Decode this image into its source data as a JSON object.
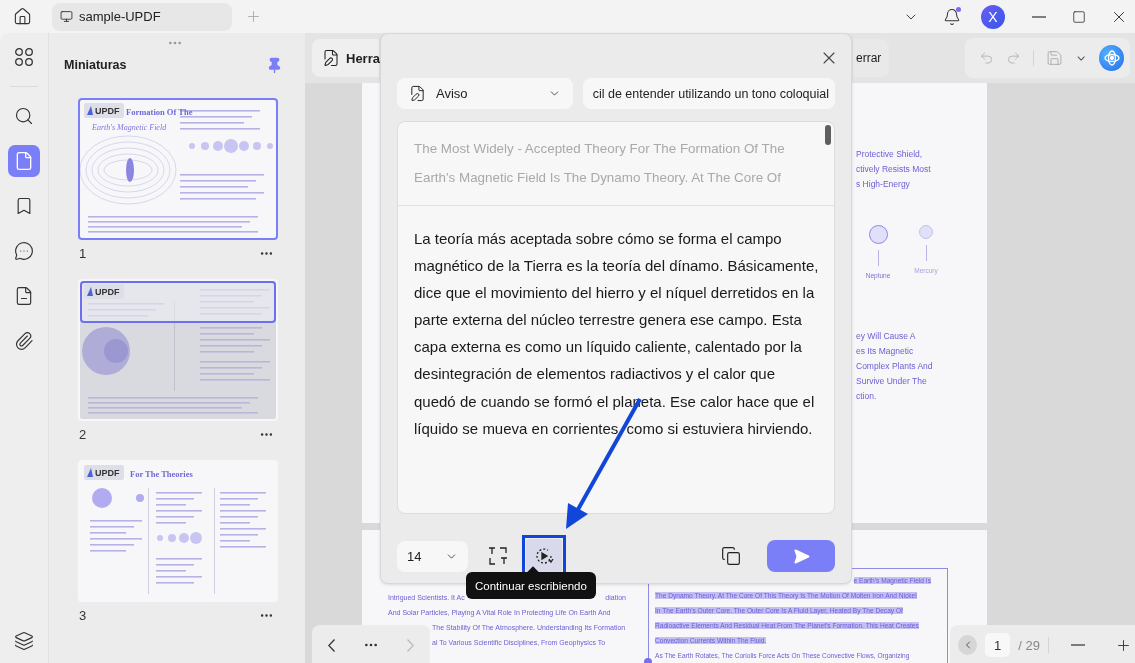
{
  "titlebar": {
    "tab_title": "sample-UPDF",
    "avatar": "X",
    "notification": true
  },
  "rail": {
    "items": [
      {
        "kind": "apps",
        "selected": false
      },
      {
        "kind": "search",
        "selected": false
      },
      {
        "kind": "pages",
        "selected": true
      },
      {
        "kind": "bookmark",
        "selected": false
      },
      {
        "kind": "comment",
        "selected": false
      },
      {
        "kind": "form",
        "selected": false
      },
      {
        "kind": "attachment",
        "selected": false
      },
      {
        "kind": "layers",
        "selected": false
      }
    ]
  },
  "thumbnails": {
    "title": "Miniaturas",
    "pinned": true,
    "pages": [
      {
        "number": "1",
        "kind": "cover",
        "selected": true,
        "shaded": false,
        "logo": "UPDF",
        "titles": [
          "Formation Of The",
          "Earth's Magnetic Field"
        ]
      },
      {
        "number": "2",
        "kind": "diagram",
        "selected": false,
        "shaded": true,
        "logo": "UPDF"
      },
      {
        "number": "3",
        "kind": "theories",
        "selected": false,
        "shaded": false,
        "logo": "UPDF",
        "titles": [
          "For The Theories"
        ]
      }
    ]
  },
  "toolbar": {
    "tools_tab": "Herra",
    "close_label": "errar"
  },
  "document": {
    "page_one": {
      "top_lines": [
        "Protective Shield,",
        "ctively Resists Most",
        "s High-Energy"
      ],
      "planets": [
        {
          "label": "Neptune",
          "selected": true
        },
        {
          "label": "Mercury",
          "selected": false
        }
      ],
      "bottom_lines": [
        "ey Will Cause A",
        "es Its Magnetic",
        "Complex Plants And",
        "Survive Under The",
        "ction."
      ]
    },
    "page_two": {
      "left_lines": [
        {
          "text": "Intrigued Scientists. It Ac",
          "tail": "diation",
          "kind": "full"
        },
        {
          "text": "And Solar Particles, Playing A Vital Role In Protecting Life On Earth And",
          "kind": "full"
        },
        {
          "text": "The Stability Of The Atmosphere. Understanding Its Formation",
          "kind": "clipped"
        },
        {
          "text": "al To Various Scientific Disciplines, From Geophysics To",
          "kind": "clipped"
        }
      ],
      "right_lines": [
        {
          "text": "e Earth's Magnetic Field Is",
          "kind": "clipped",
          "selected": true
        },
        {
          "text": "The Dynamo Theory. At The Core Of This Theory Is The Motion Of Molten Iron And Nickel",
          "kind": "full",
          "selected": true
        },
        {
          "text": "In The Earth's Outer Core. The Outer Core Is A Fluid Layer, Heated By The Decay Of",
          "kind": "full",
          "selected": true
        },
        {
          "text": "Radioactive Elements And Residual Heat From The Planet's Formation. This Heat Creates",
          "kind": "full",
          "selected": true
        },
        {
          "text": "Convection Currents Within The Fluid.",
          "kind": "full",
          "selected": true
        },
        {
          "text": "As The Earth Rotates, The Coriolis Force Acts On These Convective Flows, Organizing",
          "kind": "full",
          "selected": false
        }
      ]
    }
  },
  "ai_dialog": {
    "mode": "Aviso",
    "prompt": "cil de entender utilizando un tono coloquial",
    "source_text": "The Most Widely - Accepted Theory For The Formation Of The Earth's Magnetic Field Is The Dynamo Theory. At The Core Of",
    "result_text": "La teoría más aceptada sobre cómo se forma el campo magnético de la Tierra es la teoría del dínamo. Básicamente, dice que el movimiento del hierro y el níquel derretidos en la parte externa del núcleo terrestre genera ese campo. Esta capa externa es como un líquido caliente, calentado por la desintegración de elementos radiactivos y el calor que quedó de cuando se formó el planeta. Ese calor hace que el líquido se mueva en corrientes, como si estuviera hirviendo.",
    "font_size": "14",
    "continue_highlighted": true,
    "tooltip": "Continuar escribiendo"
  },
  "page_nav": {
    "current": "1",
    "total": "/ 29",
    "next_disabled": true
  }
}
